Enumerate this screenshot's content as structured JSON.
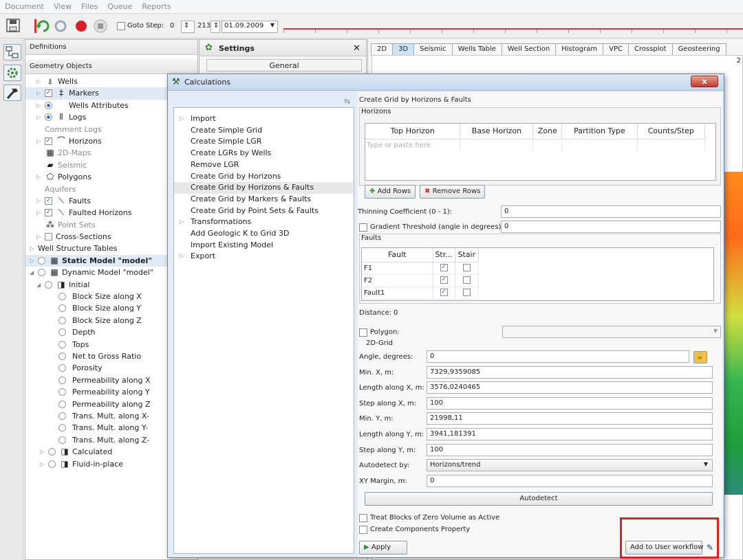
{
  "menubar": {
    "items": [
      {
        "label": "Document",
        "ul": "D"
      },
      {
        "label": "View",
        "ul": "V"
      },
      {
        "label": "Files",
        "ul": "F"
      },
      {
        "label": "Queue",
        "ul": "Q"
      },
      {
        "label": "Reports",
        "ul": "R"
      }
    ]
  },
  "toolbar": {
    "goto_step_label": "Goto Step:",
    "step_value": "0",
    "max_step": "213",
    "date": "01.09.2009"
  },
  "left_panel": {
    "header1": "Definitions",
    "header2": "Geometry Objects",
    "tree": [
      {
        "label": "Wells",
        "icon": "wells-icon",
        "depth": 1,
        "arrow": "▷",
        "check": "none"
      },
      {
        "label": "Markers",
        "icon": "markers-icon",
        "depth": 1,
        "arrow": "▷",
        "check": "checked",
        "highlight": true
      },
      {
        "label": "Wells Attributes",
        "icon": "wells-attributes-icon",
        "depth": 1,
        "arrow": "▷",
        "check": "radio-on"
      },
      {
        "label": "Logs",
        "icon": "logs-icon",
        "depth": 1,
        "arrow": "▷",
        "check": "radio-on"
      },
      {
        "label": "Comment Logs",
        "icon": "",
        "depth": 1,
        "arrow": "",
        "check": "none",
        "grey": true
      },
      {
        "label": "Horizons",
        "icon": "horizons-icon",
        "depth": 1,
        "arrow": "▷",
        "check": "checked"
      },
      {
        "label": "2D-Maps",
        "icon": "maps-icon",
        "depth": 1,
        "arrow": "",
        "check": "none",
        "grey": true
      },
      {
        "label": "Seismic",
        "icon": "seismic-icon",
        "depth": 1,
        "arrow": "",
        "check": "none",
        "grey": true
      },
      {
        "label": "Polygons",
        "icon": "polygons-icon",
        "depth": 1,
        "arrow": "▷",
        "check": "none"
      },
      {
        "label": "Aquifers",
        "icon": "",
        "depth": 1,
        "arrow": "",
        "check": "none",
        "grey": true
      },
      {
        "label": "Faults",
        "icon": "faults-icon",
        "depth": 1,
        "arrow": "▷",
        "check": "checked"
      },
      {
        "label": "Faulted Horizons",
        "icon": "faulted-horizons-icon",
        "depth": 1,
        "arrow": "▷",
        "check": "checked"
      },
      {
        "label": "Point Sets",
        "icon": "point-sets-icon",
        "depth": 1,
        "arrow": "",
        "check": "none",
        "grey": true
      },
      {
        "label": "Cross-Sections",
        "icon": "",
        "depth": 1,
        "arrow": "▷",
        "check": "unchecked"
      },
      {
        "label": "Well Structure Tables",
        "icon": "",
        "depth": 0,
        "arrow": "▷",
        "check": "none"
      },
      {
        "label": "Static Model \"model\"",
        "icon": "grid-icon",
        "depth": 0,
        "arrow": "▷",
        "check": "radio",
        "bold": true,
        "highlight": true
      },
      {
        "label": "Dynamic Model \"model\"",
        "icon": "grid-icon",
        "depth": 0,
        "arrow": "◢",
        "check": "radio"
      },
      {
        "label": "Initial",
        "icon": "cube-icon",
        "depth": 1,
        "arrow": "◢",
        "check": "radio"
      },
      {
        "label": "Block Size along X",
        "icon": "",
        "depth": 3,
        "arrow": "",
        "check": "radio"
      },
      {
        "label": "Block Size along Y",
        "icon": "",
        "depth": 3,
        "arrow": "",
        "check": "radio"
      },
      {
        "label": "Block Size along Z",
        "icon": "",
        "depth": 3,
        "arrow": "",
        "check": "radio"
      },
      {
        "label": "Depth",
        "icon": "",
        "depth": 3,
        "arrow": "",
        "check": "radio"
      },
      {
        "label": "Tops",
        "icon": "",
        "depth": 3,
        "arrow": "",
        "check": "radio"
      },
      {
        "label": "Net to Gross Ratio",
        "icon": "",
        "depth": 3,
        "arrow": "",
        "check": "radio"
      },
      {
        "label": "Porosity",
        "icon": "",
        "depth": 3,
        "arrow": "",
        "check": "radio"
      },
      {
        "label": "Permeability along X",
        "icon": "",
        "depth": 3,
        "arrow": "",
        "check": "radio"
      },
      {
        "label": "Permeability along Y",
        "icon": "",
        "depth": 3,
        "arrow": "",
        "check": "radio"
      },
      {
        "label": "Permeability along Z",
        "icon": "",
        "depth": 3,
        "arrow": "",
        "check": "radio"
      },
      {
        "label": "Trans. Mult. along X-",
        "icon": "",
        "depth": 3,
        "arrow": "",
        "check": "radio"
      },
      {
        "label": "Trans. Mult. along Y-",
        "icon": "",
        "depth": 3,
        "arrow": "",
        "check": "radio"
      },
      {
        "label": "Trans. Mult. along Z-",
        "icon": "",
        "depth": 3,
        "arrow": "",
        "check": "radio"
      },
      {
        "label": "Calculated",
        "icon": "cube-icon",
        "depth": 1.5,
        "arrow": "▷",
        "check": "radio"
      },
      {
        "label": "Fluid-in-place",
        "icon": "cube-icon",
        "depth": 1.5,
        "arrow": "▷",
        "check": "radio"
      }
    ]
  },
  "settings_panel": {
    "title": "Settings",
    "item": "General"
  },
  "right_panel": {
    "tabs": [
      "2D",
      "3D",
      "Seismic",
      "Wells Table",
      "Well Section",
      "Histogram",
      "VPC",
      "Crossplot",
      "Geosteering"
    ],
    "active_tab": "3D",
    "corner_label": "2"
  },
  "calculations": {
    "title": "Calculations",
    "close_label": "x",
    "list": [
      {
        "label": "Import",
        "arrow": "▷"
      },
      {
        "label": "Create Simple Grid",
        "arrow": ""
      },
      {
        "label": "Create Simple LGR",
        "arrow": ""
      },
      {
        "label": "Create LGRs by Wells",
        "arrow": ""
      },
      {
        "label": "Remove LGR",
        "arrow": ""
      },
      {
        "label": "Create Grid by Horizons",
        "arrow": ""
      },
      {
        "label": "Create Grid by Horizons & Faults",
        "arrow": "",
        "selected": true
      },
      {
        "label": "Create Grid by Markers & Faults",
        "arrow": ""
      },
      {
        "label": "Create Grid by Point Sets & Faults",
        "arrow": ""
      },
      {
        "label": "Transformations",
        "arrow": "▷"
      },
      {
        "label": "Add Geologic K to Grid 3D",
        "arrow": ""
      },
      {
        "label": "Import Existing Model",
        "arrow": ""
      },
      {
        "label": "Export",
        "arrow": "▷"
      }
    ],
    "form": {
      "title": "Create Grid by Horizons & Faults",
      "horizons_label": "Horizons",
      "horizons_columns": [
        "Top Horizon",
        "Base Horizon",
        "Zone",
        "Partition Type",
        "Counts/Step"
      ],
      "horizons_placeholder": "Type or paste here",
      "add_rows": "Add Rows",
      "remove_rows": "Remove Rows",
      "thinning_label": "Thinning Coefficient (0 - 1):",
      "thinning_value": "0",
      "gradient_label": "Gradient Threshold (angle in degrees):",
      "gradient_value": "0",
      "faults_label": "Faults",
      "faults_columns": [
        "Fault",
        "Str...",
        "Stair"
      ],
      "faults_rows": [
        {
          "name": "F1",
          "str": true,
          "stair": false
        },
        {
          "name": "F2",
          "str": true,
          "stair": false
        },
        {
          "name": "Fault1",
          "str": true,
          "stair": false
        }
      ],
      "distance_label": "Distance:",
      "distance_value": "0",
      "polygon_label": "Polygon:",
      "grid2d_label": "2D-Grid",
      "fields": [
        {
          "label": "Angle, degrees:",
          "value": "0"
        },
        {
          "label": "Min. X, m:",
          "value": "7329,9359085"
        },
        {
          "label": "Length along X, m:",
          "value": "3576,0240465"
        },
        {
          "label": "Step along X, m:",
          "value": "100"
        },
        {
          "label": "Min. Y, m:",
          "value": "21998,11"
        },
        {
          "label": "Length along Y, m:",
          "value": "3941,181391"
        },
        {
          "label": "Step along Y, m:",
          "value": "100"
        },
        {
          "label": "Autodetect by:",
          "value": "Horizons/trend"
        },
        {
          "label": "XY Margin, m:",
          "value": "0"
        }
      ],
      "autodetect_button": "Autodetect",
      "treat_blocks": "Treat Blocks of Zero Volume as Active",
      "create_components": "Create Components Property",
      "apply": "Apply",
      "add_workflow": "Add to User workflow"
    }
  },
  "colors": {
    "accent": "#2a6dd6",
    "highlight_box": "#e22020",
    "timeline": "#d23a3a"
  }
}
